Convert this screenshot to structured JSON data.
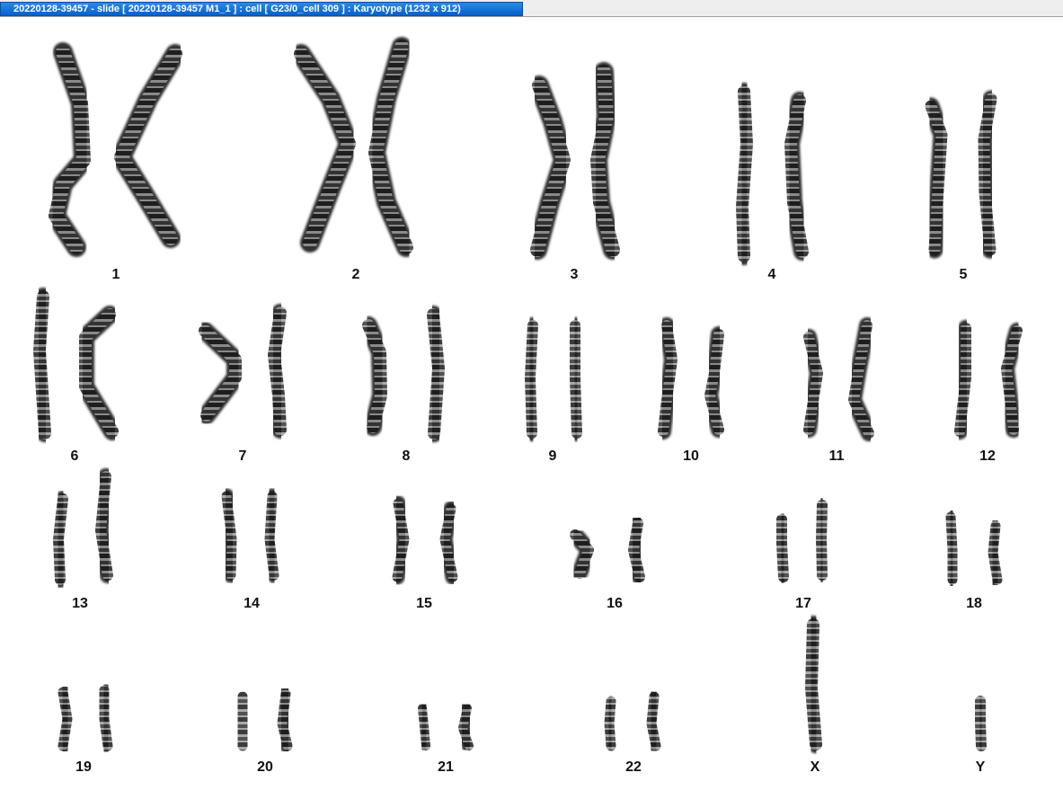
{
  "window": {
    "title": "20220128-39457 - slide [ 20220128-39457 M1_1 ] : cell [ G23/0_cell 309 ] : Karyotype  (1232 x 912)"
  },
  "colors": {
    "titlebar": "#0560cc",
    "chromosome": "#333333",
    "band_dark": "#1a1a1a",
    "band_light": "#9a9a9a"
  },
  "karyogram": {
    "chromosomes": [
      {
        "label": "1"
      },
      {
        "label": "2"
      },
      {
        "label": "3"
      },
      {
        "label": "4"
      },
      {
        "label": "5"
      },
      {
        "label": "6"
      },
      {
        "label": "7"
      },
      {
        "label": "8"
      },
      {
        "label": "9"
      },
      {
        "label": "10"
      },
      {
        "label": "11"
      },
      {
        "label": "12"
      },
      {
        "label": "13"
      },
      {
        "label": "14"
      },
      {
        "label": "15"
      },
      {
        "label": "16"
      },
      {
        "label": "17"
      },
      {
        "label": "18"
      },
      {
        "label": "19"
      },
      {
        "label": "20"
      },
      {
        "label": "21"
      },
      {
        "label": "22"
      },
      {
        "label": "X"
      },
      {
        "label": "Y"
      }
    ]
  }
}
